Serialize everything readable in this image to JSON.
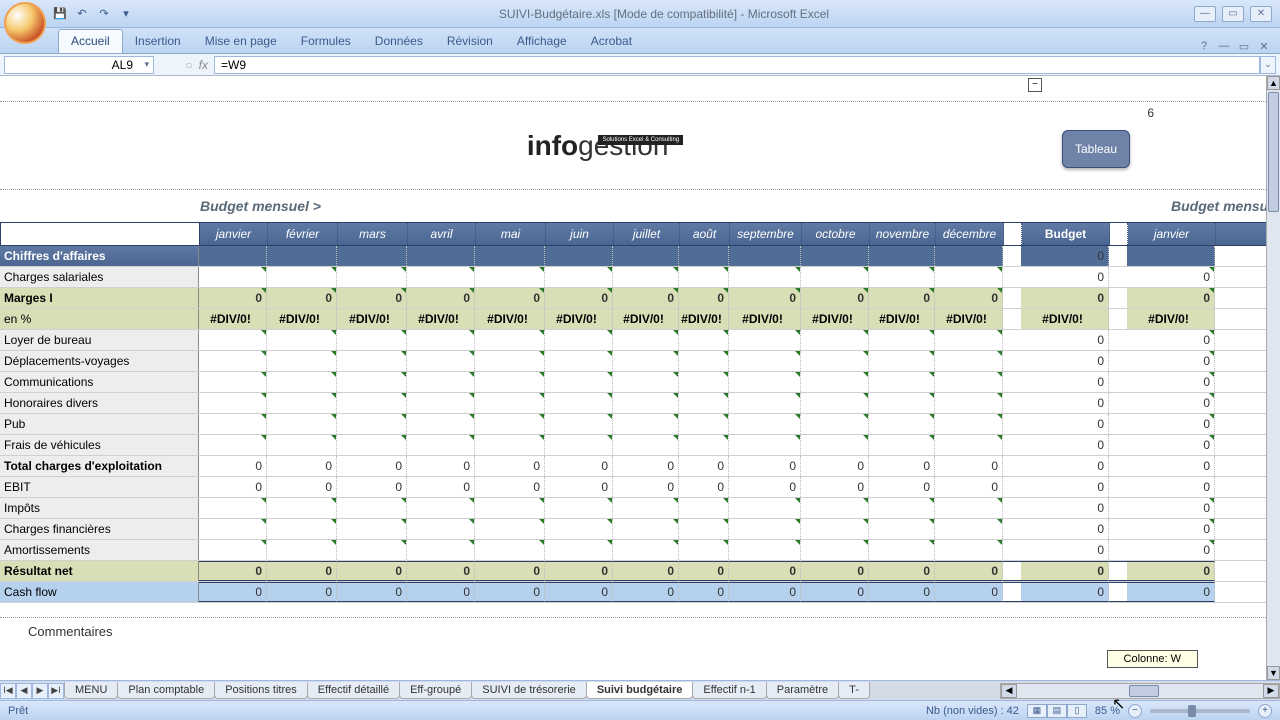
{
  "window": {
    "title": "SUIVI-Budgétaire.xls  [Mode de compatibilité] - Microsoft Excel"
  },
  "ribbon_tabs": [
    "Accueil",
    "Insertion",
    "Mise en page",
    "Formules",
    "Données",
    "Révision",
    "Affichage",
    "Acrobat"
  ],
  "active_tab_index": 0,
  "formula": {
    "cell_ref": "AL9",
    "formula_text": "=W9"
  },
  "logo": {
    "company_bold": "info",
    "company_thin": "gestion",
    "tagline": "Solutions Excel & Consulting"
  },
  "page_number": "6",
  "tableau_button": "Tableau",
  "budget_header_left": "Budget mensuel >",
  "budget_header_right": "Budget mensue",
  "months": [
    "janvier",
    "février",
    "mars",
    "avril",
    "mai",
    "juin",
    "juillet",
    "août",
    "septembre",
    "octobre",
    "novembre",
    "décembre"
  ],
  "budget_col": "Budget",
  "right_month": "janvier",
  "month_widths": [
    68,
    70,
    70,
    68,
    70,
    68,
    66,
    50,
    72,
    68,
    66,
    68
  ],
  "gap1_width": 18,
  "budget_width": 88,
  "gap2_width": 18,
  "right_month_width": 88,
  "rows": [
    {
      "key": "ca",
      "label": "Chiffres d'affaires",
      "type": "darkrow",
      "months": [
        "",
        "",
        "",
        "",
        "",
        "",
        "",
        "",
        "",
        "",
        "",
        ""
      ],
      "budget": "0",
      "right": ""
    },
    {
      "key": "charges_sal",
      "label": "Charges salariales",
      "type": "plain",
      "months": [
        "",
        "",
        "",
        "",
        "",
        "",
        "",
        "",
        "",
        "",
        "",
        ""
      ],
      "budget": "0",
      "right": "0",
      "tick": true
    },
    {
      "key": "marges",
      "label": "Marges I",
      "type": "oliverow bold-label",
      "months": [
        "0",
        "0",
        "0",
        "0",
        "0",
        "0",
        "0",
        "0",
        "0",
        "0",
        "0",
        "0"
      ],
      "budget": "0",
      "right": "0",
      "tick": true
    },
    {
      "key": "pct",
      "label": "en %",
      "type": "olivepct",
      "months": [
        "#DIV/0!",
        "#DIV/0!",
        "#DIV/0!",
        "#DIV/0!",
        "#DIV/0!",
        "#DIV/0!",
        "#DIV/0!",
        "#DIV/0!",
        "#DIV/0!",
        "#DIV/0!",
        "#DIV/0!",
        "#DIV/0!"
      ],
      "budget": "#DIV/0!",
      "right": "#DIV/0!",
      "div0": true
    },
    {
      "key": "loyer",
      "label": "Loyer de bureau",
      "type": "plain",
      "months": [
        "",
        "",
        "",
        "",
        "",
        "",
        "",
        "",
        "",
        "",
        "",
        ""
      ],
      "budget": "0",
      "right": "0",
      "tick": true
    },
    {
      "key": "dep",
      "label": "Déplacements-voyages",
      "type": "plain",
      "months": [
        "",
        "",
        "",
        "",
        "",
        "",
        "",
        "",
        "",
        "",
        "",
        ""
      ],
      "budget": "0",
      "right": "0",
      "tick": true
    },
    {
      "key": "comm",
      "label": "Communications",
      "type": "plain",
      "months": [
        "",
        "",
        "",
        "",
        "",
        "",
        "",
        "",
        "",
        "",
        "",
        ""
      ],
      "budget": "0",
      "right": "0",
      "tick": true
    },
    {
      "key": "hono",
      "label": "Honoraires divers",
      "type": "plain",
      "months": [
        "",
        "",
        "",
        "",
        "",
        "",
        "",
        "",
        "",
        "",
        "",
        ""
      ],
      "budget": "0",
      "right": "0",
      "tick": true
    },
    {
      "key": "pub",
      "label": "Pub",
      "type": "plain",
      "months": [
        "",
        "",
        "",
        "",
        "",
        "",
        "",
        "",
        "",
        "",
        "",
        ""
      ],
      "budget": "0",
      "right": "0",
      "tick": true
    },
    {
      "key": "veh",
      "label": "Frais de véhicules",
      "type": "plain",
      "months": [
        "",
        "",
        "",
        "",
        "",
        "",
        "",
        "",
        "",
        "",
        "",
        ""
      ],
      "budget": "0",
      "right": "0",
      "tick": true
    },
    {
      "key": "totexp",
      "label": "Total charges d'exploitation",
      "type": "totalrow bold-label",
      "months": [
        "0",
        "0",
        "0",
        "0",
        "0",
        "0",
        "0",
        "0",
        "0",
        "0",
        "0",
        "0"
      ],
      "budget": "0",
      "right": "0"
    },
    {
      "key": "ebit",
      "label": "EBIT",
      "type": "plain",
      "months": [
        "0",
        "0",
        "0",
        "0",
        "0",
        "0",
        "0",
        "0",
        "0",
        "0",
        "0",
        "0"
      ],
      "budget": "0",
      "right": "0"
    },
    {
      "key": "impots",
      "label": "Impôts",
      "type": "plain",
      "months": [
        "",
        "",
        "",
        "",
        "",
        "",
        "",
        "",
        "",
        "",
        "",
        ""
      ],
      "budget": "0",
      "right": "0",
      "tick": true
    },
    {
      "key": "chfin",
      "label": "Charges financières",
      "type": "plain",
      "months": [
        "",
        "",
        "",
        "",
        "",
        "",
        "",
        "",
        "",
        "",
        "",
        ""
      ],
      "budget": "0",
      "right": "0",
      "tick": true
    },
    {
      "key": "amort",
      "label": "Amortissements",
      "type": "plain",
      "months": [
        "",
        "",
        "",
        "",
        "",
        "",
        "",
        "",
        "",
        "",
        "",
        ""
      ],
      "budget": "0",
      "right": "0",
      "tick": true
    },
    {
      "key": "resnet",
      "label": "Résultat net",
      "type": "resultrow bold-label",
      "months": [
        "0",
        "0",
        "0",
        "0",
        "0",
        "0",
        "0",
        "0",
        "0",
        "0",
        "0",
        "0"
      ],
      "budget": "0",
      "right": "0"
    },
    {
      "key": "cash",
      "label": "Cash flow",
      "type": "cashrow",
      "months": [
        "0",
        "0",
        "0",
        "0",
        "0",
        "0",
        "0",
        "0",
        "0",
        "0",
        "0",
        "0"
      ],
      "budget": "0",
      "right": "0"
    }
  ],
  "comments_label": "Commentaires",
  "column_tooltip": "Colonne: W",
  "sheet_tabs": [
    "MENU",
    "Plan comptable",
    "Positions titres",
    "Effectif détaillé",
    "Eff-groupé",
    "SUIVI de trésorerie",
    "Suivi budgétaire",
    "Effectif n-1",
    "Paramètre",
    "T-"
  ],
  "active_sheet_index": 6,
  "status": {
    "ready": "Prêt",
    "count": "Nb (non vides) : 42",
    "zoom": "85 %"
  }
}
